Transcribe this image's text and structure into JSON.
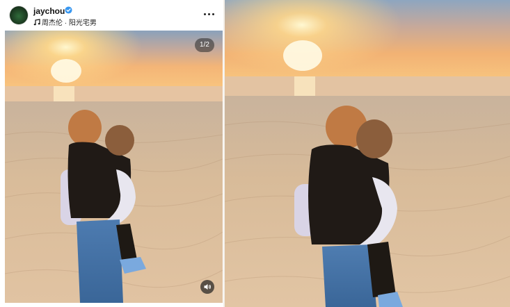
{
  "post": {
    "username": "jaychou",
    "music": "周杰伦 · 阳光宅男",
    "page_counter": "1/2"
  },
  "icons": {
    "verified": "verified-badge-icon",
    "music": "music-note-icon",
    "more": "more-options-icon",
    "audio": "speaker-icon"
  },
  "colors": {
    "verified_blue": "#3897f0",
    "sky_top": "#8aa3bf",
    "sun": "#fff2b0",
    "sand": "#d9b996"
  }
}
